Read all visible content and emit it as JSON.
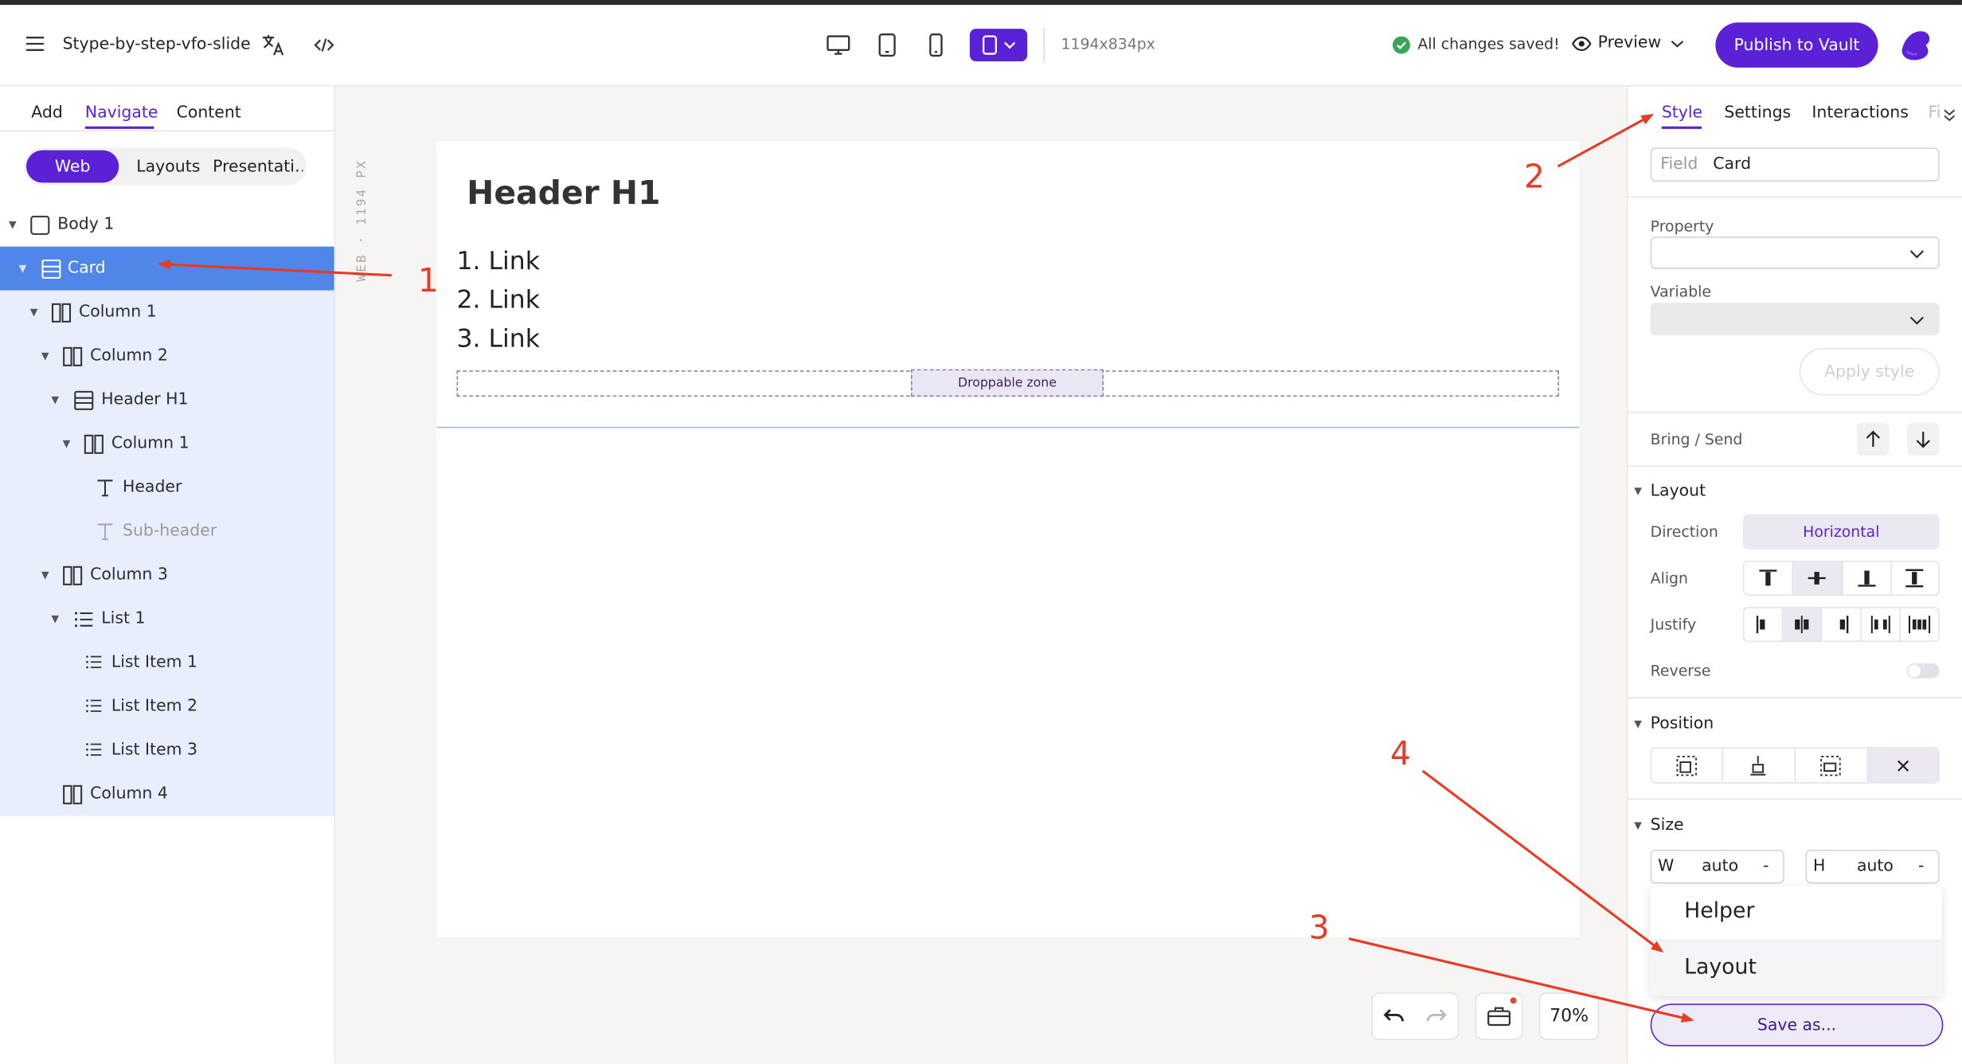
{
  "topbar": {
    "project_name": "Stype-by-step-vfo-slide",
    "canvas_size": "1194x834px",
    "save_status": "All changes saved!",
    "preview_label": "Preview",
    "publish_label": "Publish to Vault"
  },
  "left_panel": {
    "tabs": [
      {
        "label": "Add"
      },
      {
        "label": "Navigate"
      },
      {
        "label": "Content"
      }
    ],
    "active_tab": "Navigate",
    "segments": [
      {
        "label": "Web"
      },
      {
        "label": "Layouts"
      },
      {
        "label": "Presentati…"
      }
    ],
    "tree": [
      {
        "label": "Body 1",
        "icon": "square-icon"
      },
      {
        "label": "Card",
        "icon": "card-icon"
      },
      {
        "label": "Column 1",
        "icon": "columns-icon"
      },
      {
        "label": "Column 2",
        "icon": "columns-icon"
      },
      {
        "label": "Header H1",
        "icon": "card-icon"
      },
      {
        "label": "Column 1",
        "icon": "columns-icon"
      },
      {
        "label": "Header",
        "icon": "text-icon"
      },
      {
        "label": "Sub-header",
        "icon": "text-icon"
      },
      {
        "label": "Column 3",
        "icon": "columns-icon"
      },
      {
        "label": "List 1",
        "icon": "list-icon"
      },
      {
        "label": "List Item 1",
        "icon": "list-icon"
      },
      {
        "label": "List Item 2",
        "icon": "list-icon"
      },
      {
        "label": "List Item 3",
        "icon": "list-icon"
      },
      {
        "label": "Column 4",
        "icon": "columns-icon"
      }
    ]
  },
  "canvas": {
    "ruler_label": "WEB · 1194 PX",
    "heading": "Header H1",
    "links": [
      "1. Link",
      "2. Link",
      "3. Link"
    ],
    "drop_zone": "Droppable zone",
    "zoom": "70%"
  },
  "right_panel": {
    "tabs": [
      {
        "label": "Style"
      },
      {
        "label": "Settings"
      },
      {
        "label": "Interactions"
      },
      {
        "label": "Fi"
      }
    ],
    "field_label": "Field",
    "field_value": "Card",
    "property_label": "Property",
    "variable_label": "Variable",
    "apply_style": "Apply style",
    "bring_send": "Bring / Send",
    "layout_heading": "Layout",
    "direction_label": "Direction",
    "direction_value": "Horizontal",
    "align_label": "Align",
    "justify_label": "Justify",
    "reverse_label": "Reverse",
    "position_heading": "Position",
    "size_heading": "Size",
    "width_label": "W",
    "width_value": "auto",
    "height_label": "H",
    "height_value": "auto",
    "dash": "-",
    "menu_items": [
      {
        "label": "Helper"
      },
      {
        "label": "Layout"
      }
    ],
    "save_as": "Save as..."
  },
  "annotations": [
    "1",
    "2",
    "3",
    "4"
  ],
  "colors": {
    "accent": "#5b21d6",
    "selection": "#4f86e8",
    "tree_bg": "#e8eefb",
    "annotation": "#e63b24"
  }
}
